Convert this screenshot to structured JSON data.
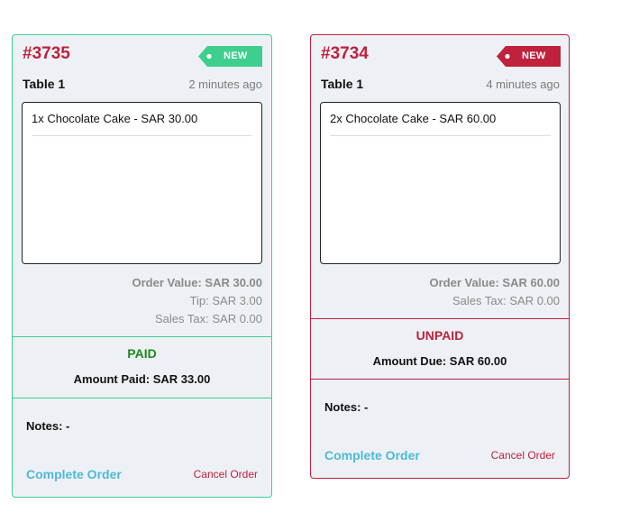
{
  "colors": {
    "paid_green": "#3ecf8e",
    "unpaid_red": "#c0213d",
    "link_blue": "#4fb8d8"
  },
  "orders": [
    {
      "number": "#3735",
      "badge": "NEW",
      "badge_color": "#3ecf8e",
      "table": "Table 1",
      "time_ago": "2 minutes ago",
      "items": [
        "1x Chocolate Cake - SAR 30.00"
      ],
      "order_value": "Order Value: SAR 30.00",
      "tip": "Tip: SAR 3.00",
      "sales_tax": "Sales Tax: SAR 0.00",
      "payment_status": "PAID",
      "payment_status_color": "#1e8a1e",
      "amount_line": "Amount Paid: SAR 33.00",
      "notes": "Notes: -",
      "complete_label": "Complete Order",
      "cancel_label": "Cancel Order"
    },
    {
      "number": "#3734",
      "badge": "NEW",
      "badge_color": "#c0213d",
      "table": "Table 1",
      "time_ago": "4 minutes ago",
      "items": [
        "2x Chocolate Cake - SAR 60.00"
      ],
      "order_value": "Order Value: SAR 60.00",
      "sales_tax": "Sales Tax: SAR 0.00",
      "payment_status": "UNPAID",
      "payment_status_color": "#c0213d",
      "amount_line": "Amount Due: SAR 60.00",
      "notes": "Notes: -",
      "complete_label": "Complete Order",
      "cancel_label": "Cancel Order"
    }
  ]
}
